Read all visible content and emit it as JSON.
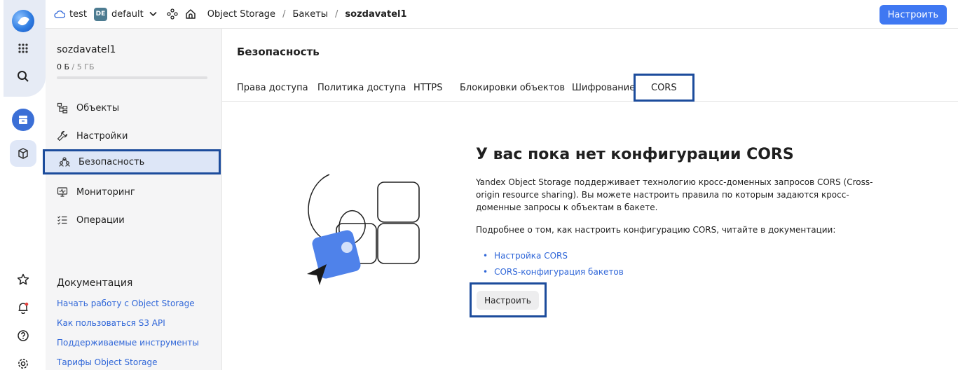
{
  "topbar": {
    "cloud": "test",
    "folder_badge": "DE",
    "folder": "default",
    "breadcrumbs": [
      "Object Storage",
      "Бакеты"
    ],
    "current": "sozdavatel1",
    "separator": "/",
    "configure_button": "Настроить",
    "accent_color": "#3f78f2"
  },
  "sidebar": {
    "bucket_name": "sozdavatel1",
    "quota_used": "0 Б",
    "quota_total": "/ 5 ГБ",
    "items": [
      {
        "label": "Объекты",
        "icon": "objects-icon"
      },
      {
        "label": "Настройки",
        "icon": "wrench-icon"
      },
      {
        "label": "Безопасность",
        "icon": "users-icon",
        "active": true
      },
      {
        "label": "Мониторинг",
        "icon": "monitor-icon"
      },
      {
        "label": "Операции",
        "icon": "list-icon"
      }
    ],
    "docs_title": "Документация",
    "docs_links": [
      "Начать работу с Object Storage",
      "Как пользоваться S3 API",
      "Поддерживаемые инструменты",
      "Тарифы Object Storage"
    ]
  },
  "main": {
    "title": "Безопасность",
    "tabs": [
      {
        "label": "Права доступа"
      },
      {
        "label": "Политика доступа"
      },
      {
        "label": "HTTPS"
      },
      {
        "label": "Блокировки объектов"
      },
      {
        "label": "Шифрование"
      },
      {
        "label": "CORS",
        "active": true
      }
    ],
    "empty": {
      "title": "У вас пока нет конфигурации CORS",
      "text": "Yandex Object Storage поддерживает технологию кросс-доменных запросов CORS (Cross-origin resource sharing). Вы можете настроить правила по которым задаются кросс-доменные запросы к объектам в бакете.",
      "sub": "Подробнее о том, как настроить конфигурацию CORS, читайте в документации:",
      "links": [
        "Настройка CORS",
        "CORS-конфигурация бакетов"
      ],
      "button": "Настроить"
    }
  }
}
